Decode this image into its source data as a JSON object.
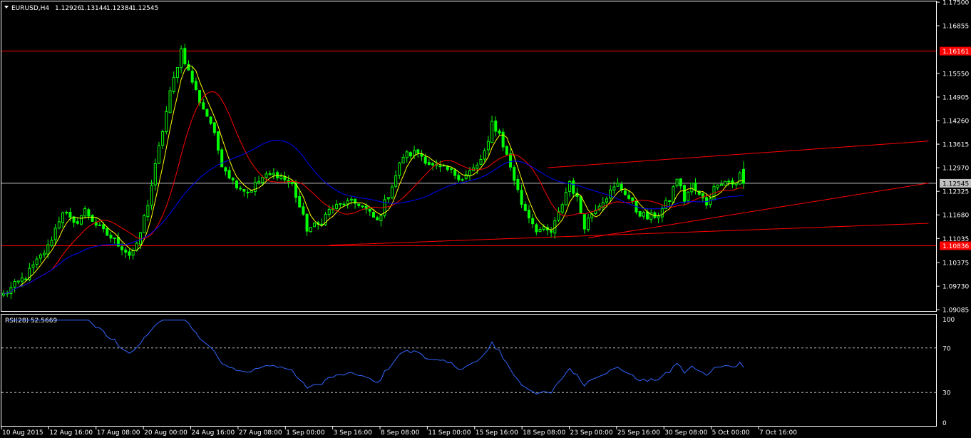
{
  "main_header": {
    "symbol": "EURUSD,H4",
    "open": "1.12926",
    "high": "1.13144",
    "low": "1.12384",
    "close": "1.12545"
  },
  "rsi_header": "RSI(28) 52.5669",
  "colors": {
    "background": "#000000",
    "candle": "#00ff00",
    "ma_fast": "#ffff00",
    "ma_mid": "#ff0000",
    "ma_slow": "#0000ff",
    "rsi": "#3366ff",
    "trendline": "#ff0000",
    "hline": "#ff0000",
    "bid_line": "#c0c0c0",
    "axis": "#ffffff"
  },
  "chart_data": [
    {
      "type": "candlestick",
      "title": "",
      "symbol": "EURUSD",
      "timeframe": "H4",
      "y_ticks": [
        "1.17500",
        "1.16855",
        "1.16161",
        "1.15550",
        "1.14905",
        "1.14260",
        "1.13615",
        "1.12970",
        "1.12545",
        "1.12325",
        "1.11680",
        "1.11035",
        "1.10836",
        "1.10375",
        "1.09730",
        "1.09085"
      ],
      "ylim": [
        1.0905,
        1.1752
      ],
      "x_ticks": [
        "10 Aug 2015",
        "12 Aug 16:00",
        "17 Aug 08:00",
        "20 Aug 00:00",
        "24 Aug 16:00",
        "27 Aug 08:00",
        "1 Sep 00:00",
        "3 Sep 16:00",
        "8 Sep 08:00",
        "11 Sep 00:00",
        "15 Sep 16:00",
        "18 Sep 08:00",
        "23 Sep 00:00",
        "25 Sep 16:00",
        "30 Sep 08:00",
        "5 Oct 00:00",
        "7 Oct 16:00"
      ],
      "close_path": [
        [
          0,
          1.095
        ],
        [
          6,
          1.1
        ],
        [
          12,
          1.108
        ],
        [
          16,
          1.118
        ],
        [
          19,
          1.114
        ],
        [
          22,
          1.118
        ],
        [
          26,
          1.113
        ],
        [
          31,
          1.109
        ],
        [
          34,
          1.106
        ],
        [
          36,
          1.108
        ],
        [
          39,
          1.12
        ],
        [
          42,
          1.135
        ],
        [
          45,
          1.15
        ],
        [
          48,
          1.162
        ],
        [
          50,
          1.156
        ],
        [
          53,
          1.148
        ],
        [
          56,
          1.142
        ],
        [
          59,
          1.131
        ],
        [
          62,
          1.126
        ],
        [
          66,
          1.123
        ],
        [
          70,
          1.127
        ],
        [
          74,
          1.128
        ],
        [
          78,
          1.125
        ],
        [
          82,
          1.113
        ],
        [
          85,
          1.114
        ],
        [
          88,
          1.118
        ],
        [
          92,
          1.12
        ],
        [
          96,
          1.12
        ],
        [
          101,
          1.115
        ],
        [
          105,
          1.125
        ],
        [
          108,
          1.133
        ],
        [
          112,
          1.134
        ],
        [
          116,
          1.13
        ],
        [
          120,
          1.129
        ],
        [
          124,
          1.127
        ],
        [
          128,
          1.13
        ],
        [
          131,
          1.136
        ],
        [
          132,
          1.142
        ],
        [
          134,
          1.139
        ],
        [
          137,
          1.13
        ],
        [
          140,
          1.12
        ],
        [
          144,
          1.113
        ],
        [
          148,
          1.112
        ],
        [
          150,
          1.117
        ],
        [
          153,
          1.126
        ],
        [
          155,
          1.121
        ],
        [
          157,
          1.114
        ],
        [
          160,
          1.119
        ],
        [
          163,
          1.122
        ],
        [
          166,
          1.125
        ],
        [
          168,
          1.123
        ],
        [
          171,
          1.118
        ],
        [
          174,
          1.116
        ],
        [
          177,
          1.117
        ],
        [
          180,
          1.121
        ],
        [
          182,
          1.127
        ],
        [
          184,
          1.121
        ],
        [
          186,
          1.125
        ],
        [
          188,
          1.122
        ],
        [
          190,
          1.12
        ],
        [
          193,
          1.126
        ],
        [
          196,
          1.126
        ],
        [
          198,
          1.125
        ],
        [
          199,
          1.128
        ],
        [
          200,
          1.1255
        ]
      ],
      "moving_averages": [
        {
          "color": "#ffff00"
        },
        {
          "color": "#ff0000"
        },
        {
          "color": "#0000ff"
        }
      ],
      "horizontal_lines": [
        {
          "price": 1.16161,
          "label": "1.16161",
          "color": "#ff0000"
        },
        {
          "price": 1.10836,
          "label": "1.10836",
          "color": "#ff0000"
        },
        {
          "price": 1.12545,
          "label": "1.12545",
          "color": "#c0c0c0"
        }
      ],
      "trend_lines": [
        {
          "x1": 147,
          "y1": 1.1297,
          "x2": 250,
          "y2": 1.137
        },
        {
          "x1": 88,
          "y1": 1.1085,
          "x2": 250,
          "y2": 1.1145
        },
        {
          "x1": 158,
          "y1": 1.1105,
          "x2": 250,
          "y2": 1.1255
        }
      ]
    },
    {
      "type": "line",
      "title": "",
      "indicator": "RSI(28)",
      "value": 52.5669,
      "ylim": [
        0,
        100
      ],
      "y_ticks": [
        "100",
        "70",
        "30",
        "0"
      ],
      "levels": [
        70,
        30
      ]
    }
  ]
}
